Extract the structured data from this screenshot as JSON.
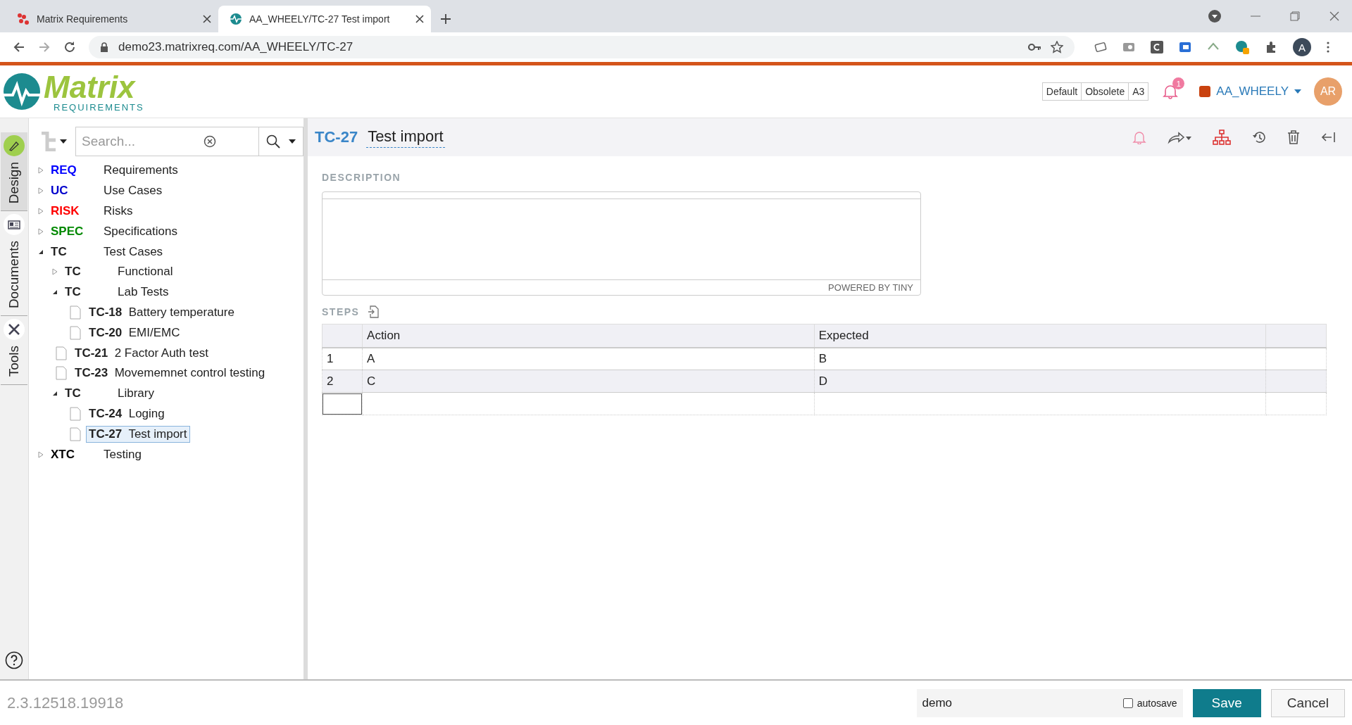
{
  "browser": {
    "tabs": [
      {
        "title": "Matrix Requirements",
        "selected": false
      },
      {
        "title": "AA_WHEELY/TC-27 Test import",
        "selected": true
      }
    ],
    "address": "demo23.matrixreq.com/AA_WHEELY/TC-27",
    "profile": "A"
  },
  "header": {
    "logo": {
      "name": "Matrix",
      "tagline": "REQUIREMENTS"
    },
    "filters": [
      {
        "label": "Default"
      },
      {
        "label": "Obsolete"
      },
      {
        "label": "A3"
      }
    ],
    "notifications": "1",
    "project": "AA_WHEELY",
    "avatar": "AR"
  },
  "side_tabs": [
    {
      "label": "Design",
      "selected": true
    },
    {
      "label": "Documents",
      "selected": false
    },
    {
      "label": "Tools",
      "selected": false
    }
  ],
  "tree": {
    "search": {
      "placeholder": "Search..."
    },
    "items": [
      {
        "kind": "folder",
        "code": "REQ",
        "title": "Requirements",
        "color": "#0000ff",
        "expanded": false
      },
      {
        "kind": "folder",
        "code": "UC",
        "title": "Use Cases",
        "color": "#0000cc",
        "expanded": false
      },
      {
        "kind": "folder",
        "code": "RISK",
        "title": "Risks",
        "color": "#ff0000",
        "expanded": false
      },
      {
        "kind": "folder",
        "code": "SPEC",
        "title": "Specifications",
        "color": "#008800",
        "expanded": false
      },
      {
        "kind": "folder",
        "code": "TC",
        "title": "Test Cases",
        "color": "#222222",
        "expanded": true,
        "children": [
          {
            "kind": "folder",
            "code": "TC",
            "title": "Functional",
            "color": "#222222",
            "expanded": false
          },
          {
            "kind": "folder",
            "code": "TC",
            "title": "Lab Tests",
            "color": "#222222",
            "expanded": true,
            "children": [
              {
                "kind": "item",
                "code": "TC-18",
                "title": "Battery temperature",
                "selected": false
              },
              {
                "kind": "item",
                "code": "TC-20",
                "title": "EMI/EMC",
                "selected": false
              }
            ]
          },
          {
            "kind": "item",
            "code": "TC-21",
            "title": "2 Factor Auth test",
            "selected": false
          },
          {
            "kind": "item",
            "code": "TC-23",
            "title": "Movememnet control testing",
            "selected": false
          },
          {
            "kind": "folder",
            "code": "TC",
            "title": "Library",
            "color": "#222222",
            "expanded": true,
            "children": [
              {
                "kind": "item",
                "code": "TC-24",
                "title": "Loging",
                "selected": false
              },
              {
                "kind": "item",
                "code": "TC-27",
                "title": "Test import",
                "selected": true
              }
            ]
          }
        ]
      },
      {
        "kind": "folder",
        "code": "XTC",
        "title": "Testing",
        "color": "#000000",
        "expanded": false
      }
    ]
  },
  "item": {
    "id": "TC-27",
    "title": "Test import",
    "description": {
      "label": "DESCRIPTION",
      "footer": "POWERED BY TINY"
    },
    "steps": {
      "label": "STEPS",
      "columns": [
        "Action",
        "Expected"
      ],
      "rows": [
        {
          "number": "1",
          "action": "A",
          "expected": "B"
        },
        {
          "number": "2",
          "action": "C",
          "expected": "D"
        }
      ]
    }
  },
  "footer": {
    "version": "2.3.12518.19918",
    "user": "demo",
    "autosave": {
      "label": "autosave",
      "checked": false
    },
    "buttons": [
      "Save",
      "Cancel"
    ]
  }
}
